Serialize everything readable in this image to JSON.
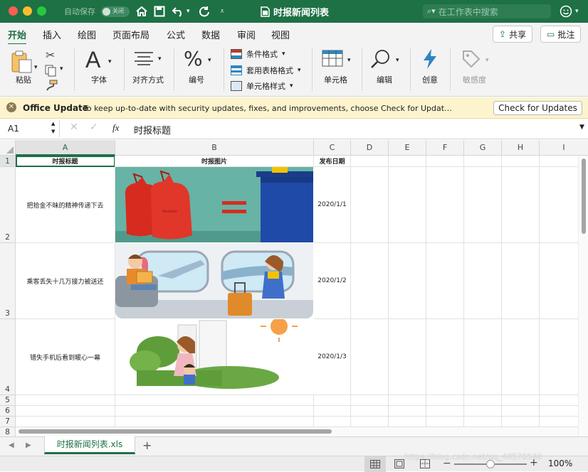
{
  "titlebar": {
    "autosave_label": "自动保存",
    "autosave_state": "关闭",
    "doc_title": "时报新闻列表",
    "search_placeholder": "在工作表中搜索"
  },
  "tabs": [
    "开始",
    "插入",
    "绘图",
    "页面布局",
    "公式",
    "数据",
    "审阅",
    "视图"
  ],
  "share_label": "共享",
  "comment_label": "批注",
  "ribbon": {
    "paste": "粘贴",
    "font": "字体",
    "alignment": "对齐方式",
    "number": "编号",
    "conditional": "条件格式",
    "table_format": "套用表格格式",
    "cell_style": "单元格样式",
    "cells": "单元格",
    "edit": "编辑",
    "ideas": "创意",
    "sensitivity": "敏感度",
    "number_symbol": "%",
    "font_symbol": "A"
  },
  "update_bar": {
    "title": "Office Update",
    "message": "To keep up-to-date with security updates, fixes, and improvements, choose Check for Updat…",
    "button": "Check for Updates"
  },
  "formula_bar": {
    "cell_ref": "A1",
    "fx": "fx",
    "value": "时报标题"
  },
  "columns": [
    "A",
    "B",
    "C",
    "D",
    "E",
    "F",
    "G",
    "H",
    "I"
  ],
  "row_numbers": [
    "1",
    "2",
    "3",
    "4",
    "5",
    "6",
    "7",
    "8"
  ],
  "headers": {
    "title": "时报标题",
    "image": "时报图片",
    "date": "发布日期"
  },
  "rows": [
    {
      "title": "把拾金不昧的精神传递下去",
      "date": "2020/1/1",
      "image": "garbage-bags-image"
    },
    {
      "title": "乘客丢失十几万接力被送还",
      "date": "2020/1/2",
      "image": "airplane-passengers-image"
    },
    {
      "title": "错失手机后看到暖心一幕",
      "date": "2020/1/3",
      "image": "mother-child-image"
    }
  ],
  "sheet_tab": "时报新闻列表.xls",
  "zoom": "100%",
  "watermark": "https://blog.csdn.net/qq_40576540",
  "colors": {
    "accent": "#1e7045",
    "update_bar": "#fdf4ce"
  }
}
